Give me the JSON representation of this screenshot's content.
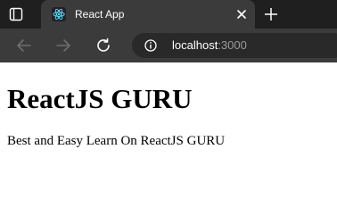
{
  "browser": {
    "tab_title": "React App",
    "url_host": "localhost",
    "url_port": ":3000",
    "icons": {
      "tab_actions": "tab-actions-icon",
      "favicon": "react-logo-icon",
      "close": "close-icon",
      "new_tab": "plus-icon",
      "back": "arrow-left-icon",
      "forward": "arrow-right-icon",
      "refresh": "refresh-icon",
      "site_info": "info-circle-icon"
    },
    "colors": {
      "tab_strip": "#1f1f1f",
      "active_tab": "#3b3b3b",
      "omnibox": "#292929"
    }
  },
  "page": {
    "heading": "ReactJS GURU",
    "paragraph": "Best and Easy Learn On ReactJS GURU"
  }
}
